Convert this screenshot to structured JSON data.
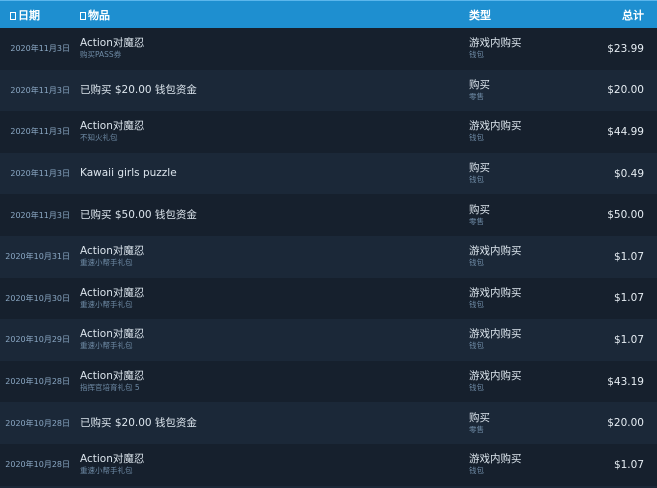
{
  "header": {
    "date": "日期",
    "item": "物品",
    "type": "类型",
    "total": "总计"
  },
  "rows": [
    {
      "date": "2020年11月3日",
      "item": "Action对魔忍",
      "item_sub": "购买PASS券",
      "type": "游戏内购买",
      "type_sub": "钱包",
      "total": "$23.99"
    },
    {
      "date": "2020年11月3日",
      "item": "已购买 $20.00 钱包资金",
      "item_sub": "",
      "type": "购买",
      "type_sub": "零售",
      "total": "$20.00"
    },
    {
      "date": "2020年11月3日",
      "item": "Action对魔忍",
      "item_sub": "不知火礼包",
      "type": "游戏内购买",
      "type_sub": "钱包",
      "total": "$44.99"
    },
    {
      "date": "2020年11月3日",
      "item": "Kawaii girls puzzle",
      "item_sub": "",
      "type": "购买",
      "type_sub": "钱包",
      "total": "$0.49"
    },
    {
      "date": "2020年11月3日",
      "item": "已购买 $50.00 钱包资金",
      "item_sub": "",
      "type": "购买",
      "type_sub": "零售",
      "total": "$50.00"
    },
    {
      "date": "2020年10月31日",
      "item": "Action对魔忍",
      "item_sub": "重速小帮手礼包",
      "type": "游戏内购买",
      "type_sub": "钱包",
      "total": "$1.07"
    },
    {
      "date": "2020年10月30日",
      "item": "Action对魔忍",
      "item_sub": "重速小帮手礼包",
      "type": "游戏内购买",
      "type_sub": "钱包",
      "total": "$1.07"
    },
    {
      "date": "2020年10月29日",
      "item": "Action对魔忍",
      "item_sub": "重速小帮手礼包",
      "type": "游戏内购买",
      "type_sub": "钱包",
      "total": "$1.07"
    },
    {
      "date": "2020年10月28日",
      "item": "Action对魔忍",
      "item_sub": "指挥官培育礼包 5",
      "type": "游戏内购买",
      "type_sub": "钱包",
      "total": "$43.19"
    },
    {
      "date": "2020年10月28日",
      "item": "已购买 $20.00 钱包资金",
      "item_sub": "",
      "type": "购买",
      "type_sub": "零售",
      "total": "$20.00"
    },
    {
      "date": "2020年10月28日",
      "item": "Action对魔忍",
      "item_sub": "重速小帮手礼包",
      "type": "游戏内购买",
      "type_sub": "钱包",
      "total": "$1.07"
    }
  ]
}
